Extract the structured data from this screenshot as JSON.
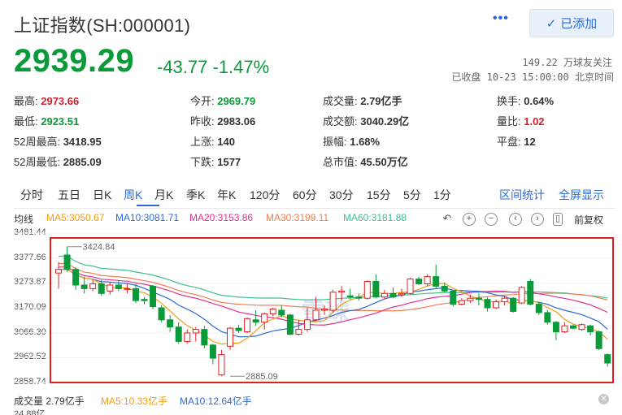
{
  "header": {
    "title": "上证指数(SH:000001)",
    "more_icon": "ellipsis-icon",
    "follow_label": "已添加",
    "follow_icon": "check-icon"
  },
  "quote": {
    "price": "2939.29",
    "change": "-43.77 -1.47%",
    "followers": "149.22 万球友关注",
    "status": "已收盘 10-23 15:00:00 北京时间"
  },
  "stats": [
    {
      "label": "最高:",
      "value": "2973.66",
      "color": "red"
    },
    {
      "label": "今开:",
      "value": "2969.79",
      "color": "green"
    },
    {
      "label": "成交量:",
      "value": "2.79亿手",
      "color": ""
    },
    {
      "label": "换手:",
      "value": "0.64%",
      "color": ""
    },
    {
      "label": "最低:",
      "value": "2923.51",
      "color": "green"
    },
    {
      "label": "昨收:",
      "value": "2983.06",
      "color": ""
    },
    {
      "label": "成交额:",
      "value": "3040.29亿",
      "color": ""
    },
    {
      "label": "量比:",
      "value": "1.02",
      "color": "red"
    },
    {
      "label": "52周最高:",
      "value": "3418.95",
      "color": ""
    },
    {
      "label": "上涨:",
      "value": "140",
      "color": ""
    },
    {
      "label": "振幅:",
      "value": "1.68%",
      "color": ""
    },
    {
      "label": "平盘:",
      "value": "12",
      "color": ""
    },
    {
      "label": "52周最低:",
      "value": "2885.09",
      "color": ""
    },
    {
      "label": "下跌:",
      "value": "1577",
      "color": ""
    },
    {
      "label": "总市值:",
      "value": "45.50万亿",
      "color": ""
    }
  ],
  "tabs": [
    "分时",
    "五日",
    "日K",
    "周K",
    "月K",
    "季K",
    "年K",
    "120分",
    "60分",
    "30分",
    "15分",
    "5分",
    "1分"
  ],
  "active_tab": "周K",
  "tab_links": {
    "interval_stats": "区间统计",
    "fullscreen": "全屏显示"
  },
  "ma_legend": {
    "label": "均线",
    "ma5": "MA5:3050.67",
    "ma10": "MA10:3081.71",
    "ma20": "MA20:3153.86",
    "ma30": "MA30:3199.11",
    "ma60": "MA60:3181.88",
    "colors": {
      "ma5": "#f39c12",
      "ma10": "#2e6bd8",
      "ma20": "#e0318d",
      "ma30": "#f07f52",
      "ma60": "#3fbf8c"
    }
  },
  "chart_controls": [
    "undo-icon",
    "zoom-in-icon",
    "zoom-out-icon",
    "pan-left-icon",
    "pan-right-icon",
    "fullscreen-icon"
  ],
  "adjust_label": "前复权",
  "watermark": "雪球",
  "volume_legend": {
    "label": "成交量 2.79亿手",
    "ma5": "MA5:10.33亿手",
    "ma10": "MA10:12.64亿手",
    "top_tick": "24.88亿"
  },
  "chart_data": {
    "type": "candlestick",
    "title": "",
    "yticks": [
      3481.44,
      3377.66,
      3273.87,
      3170.09,
      3066.3,
      2962.52,
      2858.74
    ],
    "ylim": [
      2858.74,
      3481.44
    ],
    "annotations": [
      {
        "text": "3424.84",
        "value": 3424.84,
        "index": 1
      },
      {
        "text": "2885.09",
        "value": 2885.09,
        "index": 20
      }
    ],
    "up_color": "#e02020",
    "down_color": "#0b9a3a",
    "candles": [
      {
        "o": 3315,
        "c": 3330,
        "h": 3360,
        "l": 3250
      },
      {
        "o": 3390,
        "c": 3330,
        "h": 3425,
        "l": 3320
      },
      {
        "o": 3330,
        "c": 3265,
        "h": 3340,
        "l": 3245
      },
      {
        "o": 3265,
        "c": 3250,
        "h": 3300,
        "l": 3230
      },
      {
        "o": 3250,
        "c": 3270,
        "h": 3290,
        "l": 3240
      },
      {
        "o": 3270,
        "c": 3230,
        "h": 3285,
        "l": 3220
      },
      {
        "o": 3240,
        "c": 3265,
        "h": 3275,
        "l": 3225
      },
      {
        "o": 3265,
        "c": 3250,
        "h": 3285,
        "l": 3240
      },
      {
        "o": 3250,
        "c": 3250,
        "h": 3270,
        "l": 3230
      },
      {
        "o": 3250,
        "c": 3200,
        "h": 3270,
        "l": 3190
      },
      {
        "o": 3205,
        "c": 3200,
        "h": 3215,
        "l": 3185
      },
      {
        "o": 3260,
        "c": 3175,
        "h": 3265,
        "l": 3165
      },
      {
        "o": 3170,
        "c": 3120,
        "h": 3180,
        "l": 3110
      },
      {
        "o": 3120,
        "c": 3090,
        "h": 3140,
        "l": 3070
      },
      {
        "o": 3090,
        "c": 3030,
        "h": 3110,
        "l": 3020
      },
      {
        "o": 3030,
        "c": 3065,
        "h": 3080,
        "l": 3020
      },
      {
        "o": 3065,
        "c": 3080,
        "h": 3090,
        "l": 3030
      },
      {
        "o": 3080,
        "c": 3015,
        "h": 3095,
        "l": 3000
      },
      {
        "o": 3015,
        "c": 2960,
        "h": 3020,
        "l": 2935
      },
      {
        "o": 2890,
        "c": 2975,
        "h": 2995,
        "l": 2885
      },
      {
        "o": 3010,
        "c": 3085,
        "h": 3090,
        "l": 2995
      },
      {
        "o": 3085,
        "c": 3075,
        "h": 3100,
        "l": 3065
      },
      {
        "o": 3070,
        "c": 3125,
        "h": 3130,
        "l": 3065
      },
      {
        "o": 3120,
        "c": 3110,
        "h": 3160,
        "l": 3095
      },
      {
        "o": 3110,
        "c": 3145,
        "h": 3150,
        "l": 3080
      },
      {
        "o": 3145,
        "c": 3165,
        "h": 3170,
        "l": 3135
      },
      {
        "o": 3160,
        "c": 3140,
        "h": 3180,
        "l": 3130
      },
      {
        "o": 3140,
        "c": 3060,
        "h": 3145,
        "l": 3055
      },
      {
        "o": 3060,
        "c": 3080,
        "h": 3120,
        "l": 3055
      },
      {
        "o": 3080,
        "c": 3120,
        "h": 3170,
        "l": 3070
      },
      {
        "o": 3120,
        "c": 3160,
        "h": 3215,
        "l": 3115
      },
      {
        "o": 3160,
        "c": 3165,
        "h": 3180,
        "l": 3140
      },
      {
        "o": 3160,
        "c": 3235,
        "h": 3245,
        "l": 3150
      },
      {
        "o": 3235,
        "c": 3240,
        "h": 3260,
        "l": 3200
      },
      {
        "o": 3220,
        "c": 3215,
        "h": 3250,
        "l": 3205
      },
      {
        "o": 3215,
        "c": 3210,
        "h": 3230,
        "l": 3200
      },
      {
        "o": 3210,
        "c": 3280,
        "h": 3285,
        "l": 3205
      },
      {
        "o": 3280,
        "c": 3215,
        "h": 3310,
        "l": 3210
      },
      {
        "o": 3215,
        "c": 3230,
        "h": 3245,
        "l": 3205
      },
      {
        "o": 3230,
        "c": 3215,
        "h": 3255,
        "l": 3210
      },
      {
        "o": 3225,
        "c": 3230,
        "h": 3250,
        "l": 3215
      },
      {
        "o": 3230,
        "c": 3290,
        "h": 3295,
        "l": 3225
      },
      {
        "o": 3290,
        "c": 3270,
        "h": 3300,
        "l": 3265
      },
      {
        "o": 3270,
        "c": 3300,
        "h": 3310,
        "l": 3260
      },
      {
        "o": 3300,
        "c": 3260,
        "h": 3350,
        "l": 3250
      },
      {
        "o": 3260,
        "c": 3240,
        "h": 3275,
        "l": 3235
      },
      {
        "o": 3240,
        "c": 3185,
        "h": 3245,
        "l": 3175
      },
      {
        "o": 3185,
        "c": 3200,
        "h": 3210,
        "l": 3180
      },
      {
        "o": 3200,
        "c": 3210,
        "h": 3225,
        "l": 3190
      },
      {
        "o": 3210,
        "c": 3205,
        "h": 3230,
        "l": 3180
      },
      {
        "o": 3205,
        "c": 3170,
        "h": 3215,
        "l": 3155
      },
      {
        "o": 3170,
        "c": 3195,
        "h": 3205,
        "l": 3165
      },
      {
        "o": 3195,
        "c": 3210,
        "h": 3220,
        "l": 3180
      },
      {
        "o": 3210,
        "c": 3155,
        "h": 3215,
        "l": 3150
      },
      {
        "o": 3190,
        "c": 3255,
        "h": 3260,
        "l": 3185
      },
      {
        "o": 3280,
        "c": 3185,
        "h": 3290,
        "l": 3180
      },
      {
        "o": 3185,
        "c": 3150,
        "h": 3195,
        "l": 3140
      },
      {
        "o": 3150,
        "c": 3110,
        "h": 3160,
        "l": 3100
      },
      {
        "o": 3110,
        "c": 3070,
        "h": 3115,
        "l": 3035
      },
      {
        "o": 3070,
        "c": 3095,
        "h": 3110,
        "l": 3065
      },
      {
        "o": 3095,
        "c": 3085,
        "h": 3100,
        "l": 3080
      },
      {
        "o": 3080,
        "c": 3100,
        "h": 3105,
        "l": 3075
      },
      {
        "o": 3095,
        "c": 3070,
        "h": 3100,
        "l": 3055
      },
      {
        "o": 3070,
        "c": 3000,
        "h": 3075,
        "l": 2995
      },
      {
        "o": 2975,
        "c": 2940,
        "h": 2980,
        "l": 2925
      }
    ]
  }
}
